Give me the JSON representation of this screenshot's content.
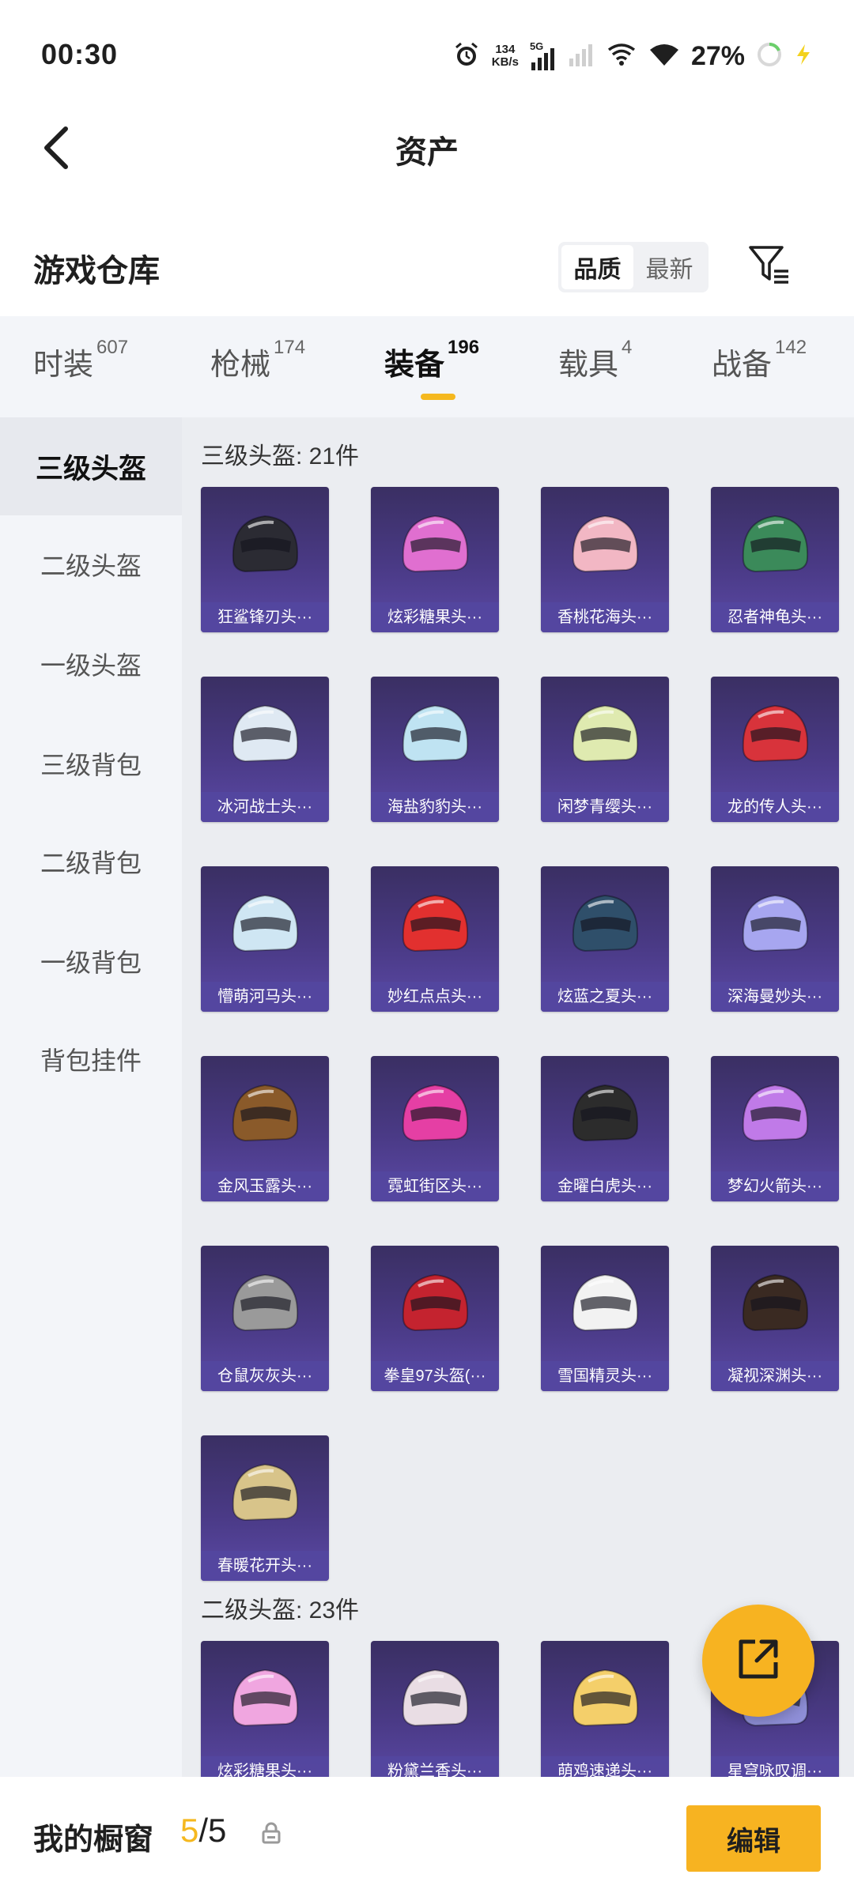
{
  "status_bar": {
    "time": "00:30",
    "net_speed_value": "134",
    "net_speed_unit": "KB/s",
    "network_type": "5G",
    "battery_percent": "27%",
    "icons": [
      "alarm-icon",
      "signal-icon",
      "wifi-icon",
      "battery-icon",
      "charging-icon"
    ]
  },
  "header": {
    "title": "资产",
    "back_icon": "chevron-left-icon"
  },
  "section": {
    "title": "游戏仓库",
    "sort_options": [
      {
        "label": "品质",
        "active": true
      },
      {
        "label": "最新",
        "active": false
      }
    ],
    "filter_icon": "filter-icon"
  },
  "tabs": [
    {
      "label": "时装",
      "count": "607",
      "active": false
    },
    {
      "label": "枪械",
      "count": "174",
      "active": false
    },
    {
      "label": "装备",
      "count": "196",
      "active": true
    },
    {
      "label": "载具",
      "count": "4",
      "active": false
    },
    {
      "label": "战备",
      "count": "142",
      "active": false
    }
  ],
  "sidebar": {
    "items": [
      {
        "label": "三级头盔",
        "active": true
      },
      {
        "label": "二级头盔",
        "active": false
      },
      {
        "label": "一级头盔",
        "active": false
      },
      {
        "label": "三级背包",
        "active": false
      },
      {
        "label": "二级背包",
        "active": false
      },
      {
        "label": "一级背包",
        "active": false
      },
      {
        "label": "背包挂件",
        "active": false
      }
    ]
  },
  "groups": [
    {
      "title": "三级头盔: 21件",
      "items": [
        {
          "name": "狂鲨锋刃头···",
          "color": "#2b2b33"
        },
        {
          "name": "炫彩糖果头···",
          "color": "#e06fd0"
        },
        {
          "name": "香桃花海头···",
          "color": "#f2b7c4"
        },
        {
          "name": "忍者神龟头···",
          "color": "#3b8a5a"
        },
        {
          "name": "冰河战士头···",
          "color": "#dfe9f3"
        },
        {
          "name": "海盐豹豹头···",
          "color": "#bfe3f2"
        },
        {
          "name": "闲梦青缨头···",
          "color": "#dfeab0"
        },
        {
          "name": "龙的传人头···",
          "color": "#d8333b"
        },
        {
          "name": "懵萌河马头···",
          "color": "#cfe6f3"
        },
        {
          "name": "妙红点点头···",
          "color": "#e2302f"
        },
        {
          "name": "炫蓝之夏头···",
          "color": "#2f4f6a"
        },
        {
          "name": "深海曼妙头···",
          "color": "#a7a6f0"
        },
        {
          "name": "金风玉露头···",
          "color": "#8a5a2a"
        },
        {
          "name": "霓虹街区头···",
          "color": "#e53fa4"
        },
        {
          "name": "金曜白虎头···",
          "color": "#2c2c2c"
        },
        {
          "name": "梦幻火箭头···",
          "color": "#c07ae8"
        },
        {
          "name": "仓鼠灰灰头···",
          "color": "#9a9a9a"
        },
        {
          "name": "拳皇97头盔(···",
          "color": "#c4232f"
        },
        {
          "name": "雪国精灵头···",
          "color": "#f2f2f2"
        },
        {
          "name": "凝视深渊头···",
          "color": "#3a2a22"
        },
        {
          "name": "春暖花开头···",
          "color": "#d8c48a"
        }
      ]
    },
    {
      "title": "二级头盔: 23件",
      "items": [
        {
          "name": "炫彩糖果头···",
          "color": "#f0a6e0"
        },
        {
          "name": "粉黛兰香头···",
          "color": "#e9dde4"
        },
        {
          "name": "萌鸡速递头···",
          "color": "#f4cf6a"
        },
        {
          "name": "星穹咏叹调···",
          "color": "#8f8fd8"
        }
      ]
    }
  ],
  "fab": {
    "icon": "share-out-icon"
  },
  "bottom_bar": {
    "title": "我的橱窗",
    "count_current": "5",
    "count_sep_total": "/5",
    "lock_icon": "lock-icon",
    "edit_label": "编辑"
  }
}
